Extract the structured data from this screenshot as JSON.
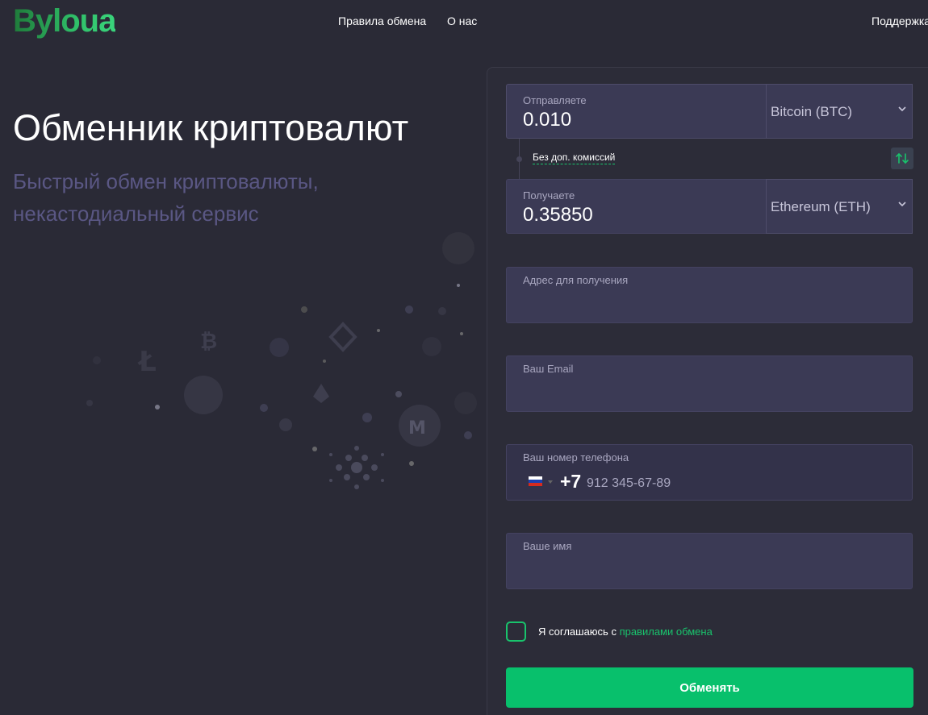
{
  "header": {
    "logo": "Byloua",
    "nav": {
      "rules": "Правила обмена",
      "about": "О нас",
      "support": "Поддержка"
    }
  },
  "hero": {
    "title": "Обменник криптовалют",
    "subtitle": "Быстрый обмен криптовалюты, некастодиальный сервис"
  },
  "exchange": {
    "send": {
      "label": "Отправляете",
      "amount": "0.010",
      "currency": "Bitcoin (BTC)"
    },
    "no_fee_label": "Без доп. комиссий",
    "receive": {
      "label": "Получаете",
      "amount": "0.35850",
      "currency": "Ethereum (ETH)"
    }
  },
  "form": {
    "address_label": "Адрес для получения",
    "email_label": "Ваш Email",
    "phone_label": "Ваш номер телефона",
    "phone_country_code": "+7",
    "phone_placeholder": "912 345-67-89",
    "name_label": "Ваше имя",
    "agree_text": "Я соглашаюсь с ",
    "agree_link": "правилами обмена",
    "submit_label": "Обменять"
  },
  "colors": {
    "background": "#2a2a36",
    "field": "#3b3a55",
    "accent": "#08c06c",
    "subtitle": "#5a5784"
  },
  "icons": [
    "chevron-down-icon",
    "swap-arrows-icon",
    "russia-flag-icon"
  ]
}
